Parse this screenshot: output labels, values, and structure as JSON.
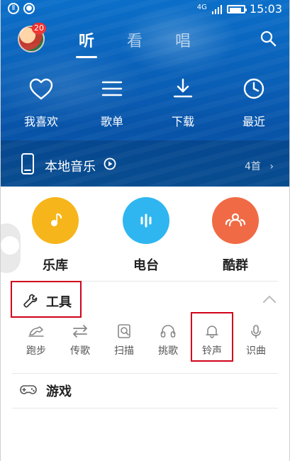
{
  "status_bar": {
    "time": "15:03",
    "network": "4G",
    "battery_level": 0.9
  },
  "header": {
    "badge_count": "20",
    "tabs": [
      {
        "label": "听",
        "active": true
      },
      {
        "label": "看",
        "active": false
      },
      {
        "label": "唱",
        "active": false
      }
    ]
  },
  "hero_actions": [
    {
      "label": "我喜欢",
      "icon": "heart-icon"
    },
    {
      "label": "歌单",
      "icon": "list-icon"
    },
    {
      "label": "下载",
      "icon": "download-icon"
    },
    {
      "label": "最近",
      "icon": "clock-icon"
    }
  ],
  "local_music": {
    "label": "本地音乐",
    "count": "4首"
  },
  "quick_entries": [
    {
      "label": "乐库",
      "color": "#f6b51a",
      "icon": "music-note-icon"
    },
    {
      "label": "电台",
      "color": "#2fb6f0",
      "icon": "radio-bars-icon"
    },
    {
      "label": "酷群",
      "color": "#f06b45",
      "icon": "group-icon"
    }
  ],
  "tools": {
    "title": "工具",
    "items": [
      {
        "label": "跑步",
        "icon": "run-icon"
      },
      {
        "label": "传歌",
        "icon": "transfer-icon"
      },
      {
        "label": "扫描",
        "icon": "scan-icon"
      },
      {
        "label": "挑歌",
        "icon": "headphones-icon"
      },
      {
        "label": "铃声",
        "icon": "bell-icon"
      },
      {
        "label": "识曲",
        "icon": "mic-icon"
      }
    ]
  },
  "games": {
    "label": "游戏"
  },
  "colors": {
    "accent_red": "#d0021b"
  }
}
